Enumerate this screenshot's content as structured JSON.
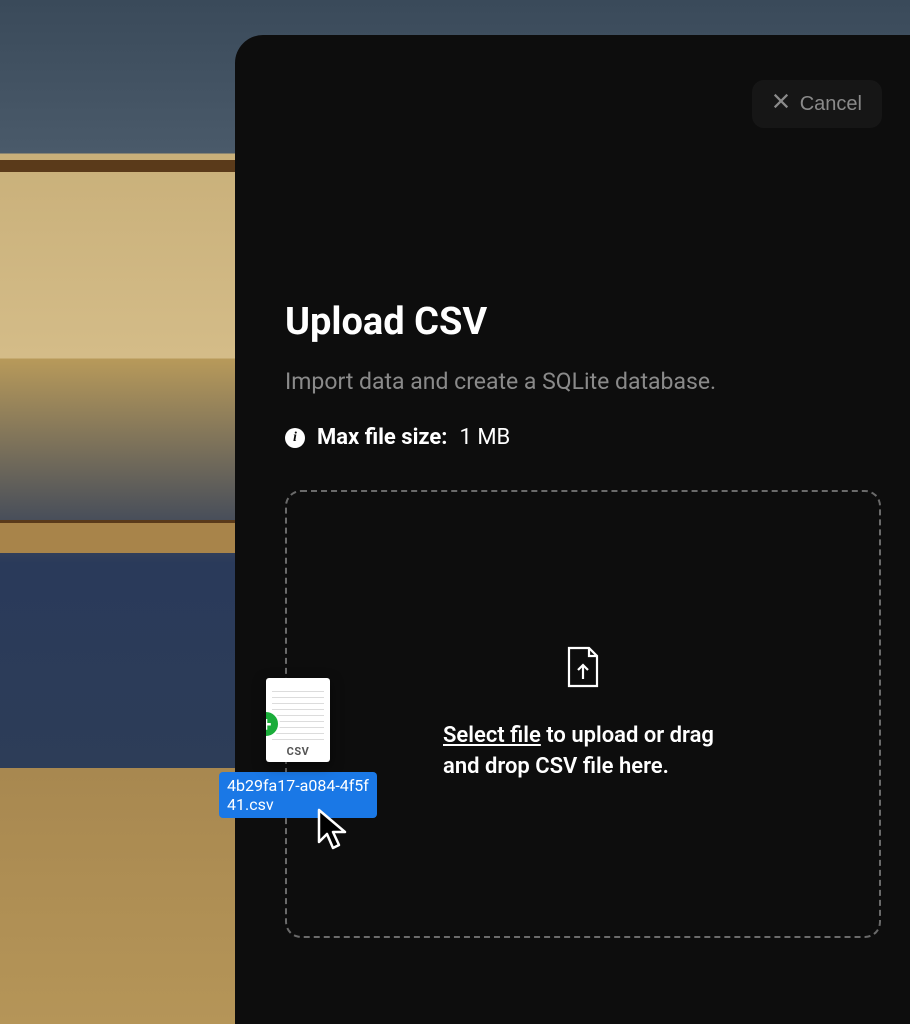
{
  "header": {
    "cancel_label": "Cancel"
  },
  "main": {
    "title": "Upload CSV",
    "subtitle": "Import data and create a SQLite database.",
    "info_label": "Max file size:",
    "info_value": "1 MB"
  },
  "dropzone": {
    "select_label": "Select file",
    "rest_text": " to upload or drag and drop CSV file here."
  },
  "dragged_file": {
    "ext": "CSV",
    "filename": "4b29fa17-a084-4f5f41.csv"
  }
}
